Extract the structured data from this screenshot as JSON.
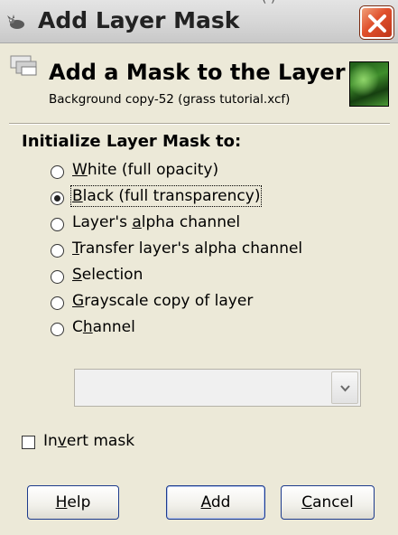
{
  "window": {
    "title": "Add Layer Mask",
    "title_peek": "(       )"
  },
  "header": {
    "title": "Add a Mask to the Layer",
    "subtitle": "Background copy-52 (grass tutorial.xcf)"
  },
  "section": {
    "title": "Initialize Layer Mask to:"
  },
  "options": [
    {
      "pre": "",
      "mn": "W",
      "post": "hite (full opacity)",
      "checked": false
    },
    {
      "pre": "",
      "mn": "B",
      "post": "lack (full transparency)",
      "checked": true
    },
    {
      "pre": "Layer's ",
      "mn": "a",
      "post": "lpha channel",
      "checked": false
    },
    {
      "pre": "",
      "mn": "T",
      "post": "ransfer layer's alpha channel",
      "checked": false
    },
    {
      "pre": "",
      "mn": "S",
      "post": "election",
      "checked": false
    },
    {
      "pre": "",
      "mn": "G",
      "post": "rayscale copy of layer",
      "checked": false
    },
    {
      "pre": "C",
      "mn": "h",
      "post": "annel",
      "checked": false
    }
  ],
  "invert": {
    "pre": "In",
    "mn": "v",
    "post": "ert mask",
    "checked": false
  },
  "buttons": {
    "help": {
      "pre": "",
      "mn": "H",
      "post": "elp"
    },
    "add": {
      "pre": "",
      "mn": "A",
      "post": "dd"
    },
    "cancel": {
      "pre": "",
      "mn": "C",
      "post": "ancel"
    }
  },
  "colors": {
    "close_button": "#e0502c",
    "dialog_bg": "#ece9d8",
    "button_border": "#1c3a8c"
  },
  "icons": {
    "title": "gimp-wilber-icon",
    "header": "layer-mask-icon",
    "close": "close-icon",
    "dropdown": "chevron-down-icon"
  }
}
